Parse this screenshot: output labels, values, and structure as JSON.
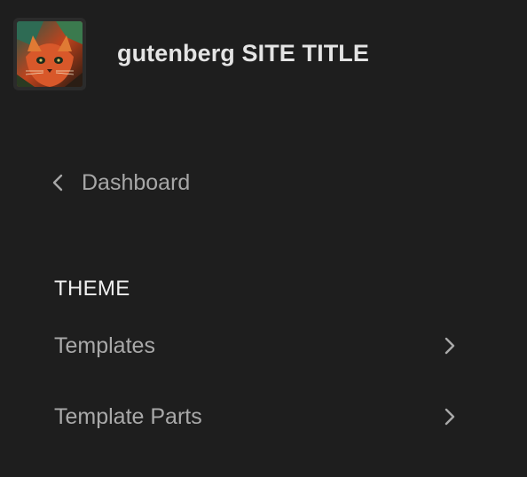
{
  "header": {
    "site_title": "gutenberg SITE TITLE",
    "site_icon": "cat-photo-thumbnail"
  },
  "navigation": {
    "back_label": "Dashboard",
    "back_icon": "chevron-left-icon",
    "section_heading": "THEME",
    "items": [
      {
        "label": "Templates",
        "icon": "chevron-right-icon"
      },
      {
        "label": "Template Parts",
        "icon": "chevron-right-icon"
      }
    ]
  },
  "colors": {
    "background": "#1e1e1e",
    "text_primary": "#e4e4e4",
    "text_secondary": "#a9a9a9"
  }
}
